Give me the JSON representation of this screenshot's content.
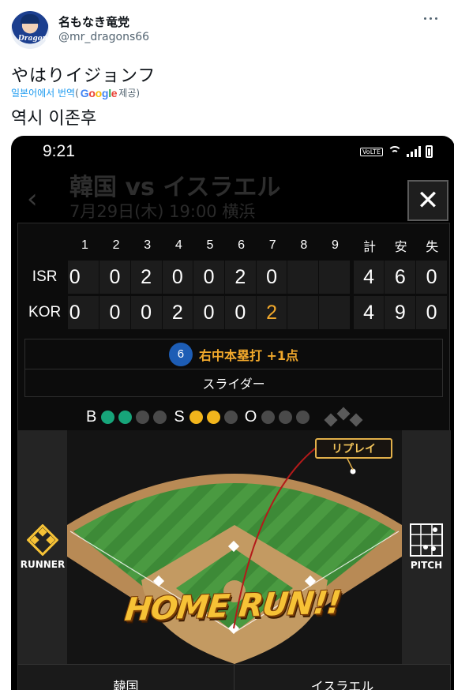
{
  "tweet": {
    "display_name": "名もなき竜党",
    "handle": "@mr_dragons66",
    "avatar_logo": "Dragons",
    "text": "やはりイジョンフ",
    "translate_label": "일본어에서 번역",
    "translate_paren_open": "(",
    "translate_paren_close": ")",
    "translate_provider_suffix": "제공",
    "google": [
      "G",
      "o",
      "o",
      "g",
      "l",
      "e"
    ],
    "translated_text": "역시 이존후"
  },
  "phone": {
    "status_time": "9:21",
    "volte": "VoLTE",
    "background_title": "韓国 vs イスラエル",
    "background_subtitle": "7月29日(木) 19:00 横浜",
    "back_icon": "‹",
    "close_icon": "✕"
  },
  "scoreboard": {
    "innings": [
      "1",
      "2",
      "3",
      "4",
      "5",
      "6",
      "7",
      "8",
      "9"
    ],
    "totals_headers": [
      "計",
      "安",
      "失"
    ],
    "teams": [
      {
        "name": "ISR",
        "innings": [
          "0",
          "0",
          "2",
          "0",
          "0",
          "2",
          "0",
          "",
          ""
        ],
        "totals": [
          "4",
          "6",
          "0"
        ]
      },
      {
        "name": "KOR",
        "innings": [
          "0",
          "0",
          "0",
          "2",
          "0",
          "0",
          "2",
          "",
          ""
        ],
        "totals": [
          "4",
          "9",
          "0"
        ]
      }
    ]
  },
  "play": {
    "batter_number": "6",
    "description": "右中本塁打 +1点",
    "pitch_type": "スライダー"
  },
  "count": {
    "balls_label": "B",
    "strikes_label": "S",
    "outs_label": "O",
    "balls": 2,
    "balls_max": 4,
    "strikes": 2,
    "strikes_max": 3,
    "outs": 0,
    "outs_max": 3,
    "colors": {
      "ball": "#17a57a",
      "strike": "#f2b51c",
      "off": "#4a4a4a"
    }
  },
  "field": {
    "runner_label": "RUNNER",
    "pitch_label": "PITCH",
    "replay_label": "リプレイ",
    "homerun_text": "HOME RUN!!"
  },
  "tabs": [
    "韓国",
    "イスラエル"
  ]
}
